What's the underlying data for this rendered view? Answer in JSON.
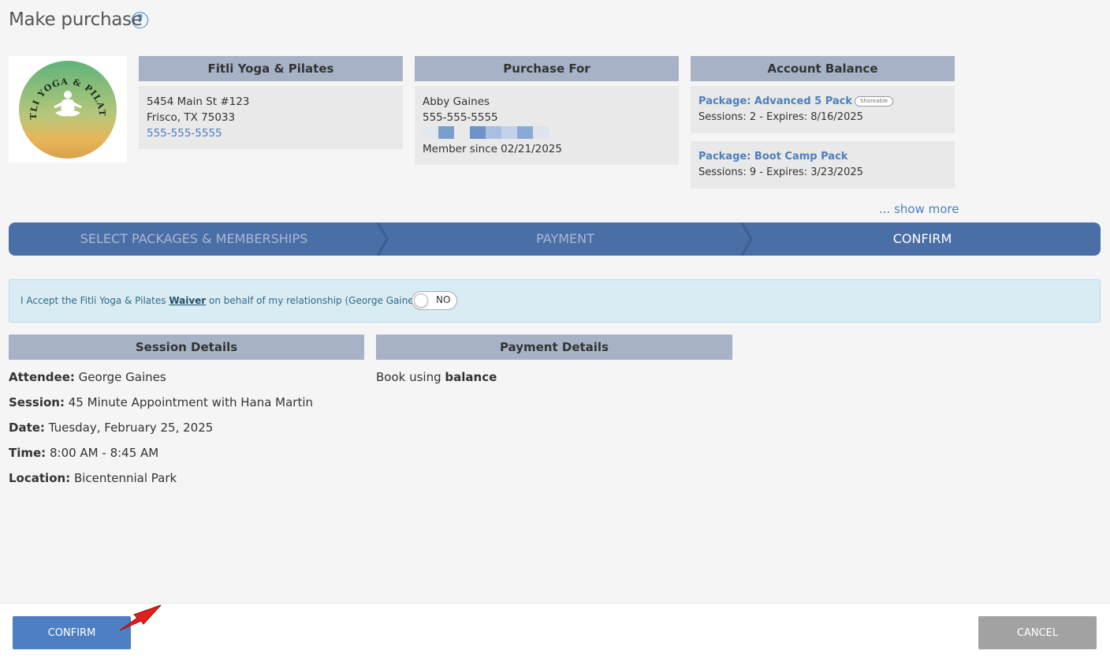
{
  "page": {
    "title": "Make purchase",
    "help_glyph": "?"
  },
  "logo": {
    "text": "FITLI YOGA & PILATES"
  },
  "studio": {
    "header": "Fitli Yoga & Pilates",
    "address_line1": "5454 Main St #123",
    "address_line2": "Frisco, TX 75033",
    "phone": "555-555-5555"
  },
  "purchase_for": {
    "header": "Purchase For",
    "name": "Abby Gaines",
    "phone": "555-555-5555",
    "member_since": "Member since 02/21/2025"
  },
  "account_balance": {
    "header": "Account Balance",
    "packages": [
      {
        "title": "Package: Advanced 5 Pack",
        "badge": "Shareable",
        "details": "Sessions: 2 -  Expires: 8/16/2025"
      },
      {
        "title": "Package: Boot Camp Pack",
        "details": "Sessions: 9 -  Expires: 3/23/2025"
      }
    ],
    "show_more": "... show more"
  },
  "steps": [
    {
      "label": "SELECT PACKAGES & MEMBERSHIPS",
      "active": false
    },
    {
      "label": "PAYMENT",
      "active": false
    },
    {
      "label": "CONFIRM",
      "active": true
    }
  ],
  "waiver": {
    "prefix": "I Accept the Fitli Yoga & Pilates ",
    "link": "Waiver",
    "suffix": " on behalf of my relationship (George Gaines)",
    "toggle_label": "NO"
  },
  "session_details": {
    "header": "Session Details",
    "attendee_label": "Attendee:",
    "attendee": "George Gaines",
    "session_label": "Session:",
    "session": "45 Minute Appointment with Hana Martin",
    "date_label": "Date:",
    "date": "Tuesday, February 25, 2025",
    "time_label": "Time:",
    "time": "8:00 AM - 8:45 AM",
    "location_label": "Location:",
    "location": "Bicentennial Park"
  },
  "payment_details": {
    "header": "Payment Details",
    "prefix": "Book using",
    "method": "balance"
  },
  "footer": {
    "confirm": "CONFIRM",
    "cancel": "CANCEL"
  },
  "colors": {
    "accent": "#4f7fc3",
    "stepper": "#4a6ea6",
    "header_bg": "#a8b2c7",
    "link": "#4d7fbd"
  }
}
